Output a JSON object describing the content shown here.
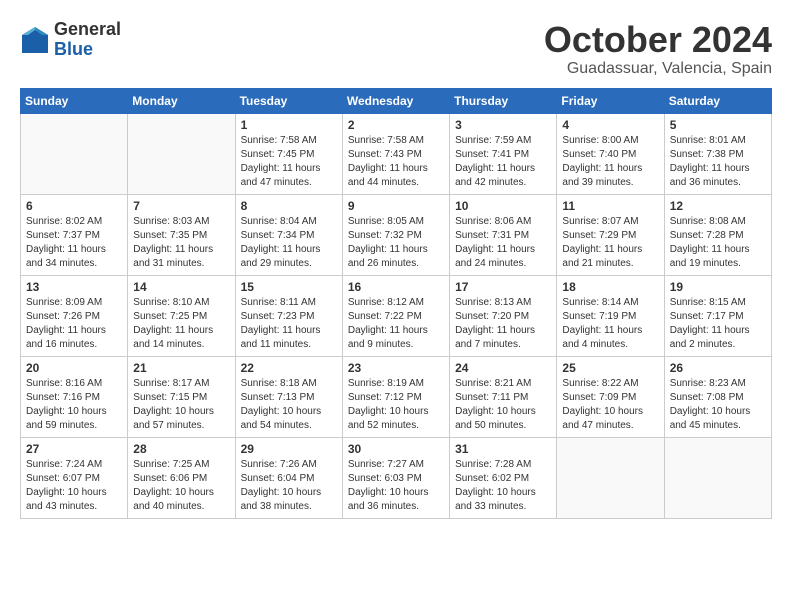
{
  "header": {
    "logo_general": "General",
    "logo_blue": "Blue",
    "month": "October 2024",
    "location": "Guadassuar, Valencia, Spain"
  },
  "weekdays": [
    "Sunday",
    "Monday",
    "Tuesday",
    "Wednesday",
    "Thursday",
    "Friday",
    "Saturday"
  ],
  "weeks": [
    [
      {
        "day": "",
        "info": ""
      },
      {
        "day": "",
        "info": ""
      },
      {
        "day": "1",
        "info": "Sunrise: 7:58 AM\nSunset: 7:45 PM\nDaylight: 11 hours and 47 minutes."
      },
      {
        "day": "2",
        "info": "Sunrise: 7:58 AM\nSunset: 7:43 PM\nDaylight: 11 hours and 44 minutes."
      },
      {
        "day": "3",
        "info": "Sunrise: 7:59 AM\nSunset: 7:41 PM\nDaylight: 11 hours and 42 minutes."
      },
      {
        "day": "4",
        "info": "Sunrise: 8:00 AM\nSunset: 7:40 PM\nDaylight: 11 hours and 39 minutes."
      },
      {
        "day": "5",
        "info": "Sunrise: 8:01 AM\nSunset: 7:38 PM\nDaylight: 11 hours and 36 minutes."
      }
    ],
    [
      {
        "day": "6",
        "info": "Sunrise: 8:02 AM\nSunset: 7:37 PM\nDaylight: 11 hours and 34 minutes."
      },
      {
        "day": "7",
        "info": "Sunrise: 8:03 AM\nSunset: 7:35 PM\nDaylight: 11 hours and 31 minutes."
      },
      {
        "day": "8",
        "info": "Sunrise: 8:04 AM\nSunset: 7:34 PM\nDaylight: 11 hours and 29 minutes."
      },
      {
        "day": "9",
        "info": "Sunrise: 8:05 AM\nSunset: 7:32 PM\nDaylight: 11 hours and 26 minutes."
      },
      {
        "day": "10",
        "info": "Sunrise: 8:06 AM\nSunset: 7:31 PM\nDaylight: 11 hours and 24 minutes."
      },
      {
        "day": "11",
        "info": "Sunrise: 8:07 AM\nSunset: 7:29 PM\nDaylight: 11 hours and 21 minutes."
      },
      {
        "day": "12",
        "info": "Sunrise: 8:08 AM\nSunset: 7:28 PM\nDaylight: 11 hours and 19 minutes."
      }
    ],
    [
      {
        "day": "13",
        "info": "Sunrise: 8:09 AM\nSunset: 7:26 PM\nDaylight: 11 hours and 16 minutes."
      },
      {
        "day": "14",
        "info": "Sunrise: 8:10 AM\nSunset: 7:25 PM\nDaylight: 11 hours and 14 minutes."
      },
      {
        "day": "15",
        "info": "Sunrise: 8:11 AM\nSunset: 7:23 PM\nDaylight: 11 hours and 11 minutes."
      },
      {
        "day": "16",
        "info": "Sunrise: 8:12 AM\nSunset: 7:22 PM\nDaylight: 11 hours and 9 minutes."
      },
      {
        "day": "17",
        "info": "Sunrise: 8:13 AM\nSunset: 7:20 PM\nDaylight: 11 hours and 7 minutes."
      },
      {
        "day": "18",
        "info": "Sunrise: 8:14 AM\nSunset: 7:19 PM\nDaylight: 11 hours and 4 minutes."
      },
      {
        "day": "19",
        "info": "Sunrise: 8:15 AM\nSunset: 7:17 PM\nDaylight: 11 hours and 2 minutes."
      }
    ],
    [
      {
        "day": "20",
        "info": "Sunrise: 8:16 AM\nSunset: 7:16 PM\nDaylight: 10 hours and 59 minutes."
      },
      {
        "day": "21",
        "info": "Sunrise: 8:17 AM\nSunset: 7:15 PM\nDaylight: 10 hours and 57 minutes."
      },
      {
        "day": "22",
        "info": "Sunrise: 8:18 AM\nSunset: 7:13 PM\nDaylight: 10 hours and 54 minutes."
      },
      {
        "day": "23",
        "info": "Sunrise: 8:19 AM\nSunset: 7:12 PM\nDaylight: 10 hours and 52 minutes."
      },
      {
        "day": "24",
        "info": "Sunrise: 8:21 AM\nSunset: 7:11 PM\nDaylight: 10 hours and 50 minutes."
      },
      {
        "day": "25",
        "info": "Sunrise: 8:22 AM\nSunset: 7:09 PM\nDaylight: 10 hours and 47 minutes."
      },
      {
        "day": "26",
        "info": "Sunrise: 8:23 AM\nSunset: 7:08 PM\nDaylight: 10 hours and 45 minutes."
      }
    ],
    [
      {
        "day": "27",
        "info": "Sunrise: 7:24 AM\nSunset: 6:07 PM\nDaylight: 10 hours and 43 minutes."
      },
      {
        "day": "28",
        "info": "Sunrise: 7:25 AM\nSunset: 6:06 PM\nDaylight: 10 hours and 40 minutes."
      },
      {
        "day": "29",
        "info": "Sunrise: 7:26 AM\nSunset: 6:04 PM\nDaylight: 10 hours and 38 minutes."
      },
      {
        "day": "30",
        "info": "Sunrise: 7:27 AM\nSunset: 6:03 PM\nDaylight: 10 hours and 36 minutes."
      },
      {
        "day": "31",
        "info": "Sunrise: 7:28 AM\nSunset: 6:02 PM\nDaylight: 10 hours and 33 minutes."
      },
      {
        "day": "",
        "info": ""
      },
      {
        "day": "",
        "info": ""
      }
    ]
  ]
}
